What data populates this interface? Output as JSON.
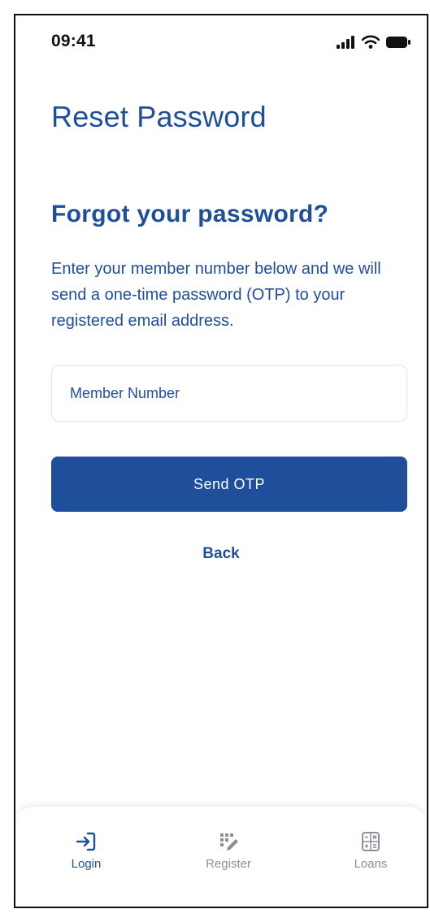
{
  "status_bar": {
    "time": "09:41",
    "icons": [
      "signal-icon",
      "wifi-icon",
      "battery-icon"
    ]
  },
  "page": {
    "title": "Reset Password",
    "heading": "Forgot your password?",
    "instructions": "Enter your member number below and we will send a one-time password (OTP) to your registered email address."
  },
  "form": {
    "member_number": {
      "value": "",
      "placeholder": "Member Number"
    },
    "send_label": "Send OTP",
    "back_label": "Back"
  },
  "tab_bar": {
    "active": "Login",
    "items": [
      {
        "label": "Login",
        "icon": "login-icon"
      },
      {
        "label": "Register",
        "icon": "register-icon"
      },
      {
        "label": "Loans",
        "icon": "calculator-icon"
      }
    ]
  },
  "colors": {
    "primary": "#1f4e9a",
    "inactive": "#8a8f98",
    "background": "#ffffff"
  }
}
